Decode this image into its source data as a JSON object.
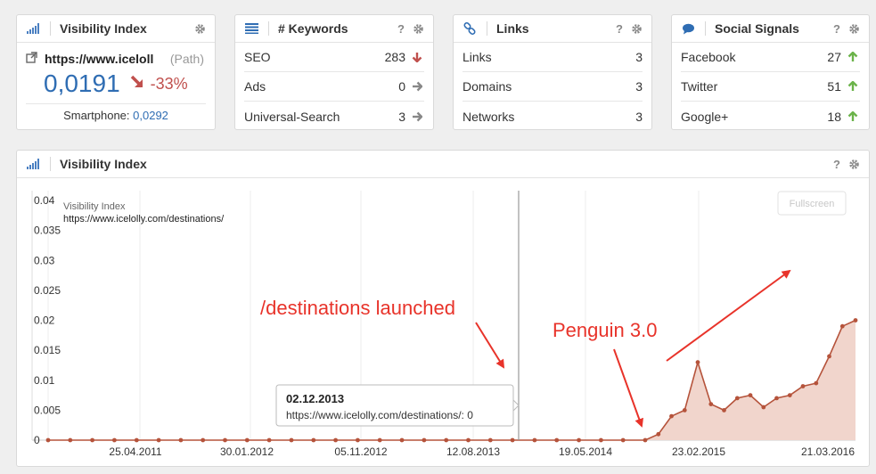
{
  "vi_card": {
    "title": "Visibility Index",
    "url": "https://www.iceloll",
    "path": "(Path)",
    "value": "0,0191",
    "change": "-33%",
    "smartphone_label": "Smartphone:",
    "smartphone_value": "0,0292"
  },
  "keywords_card": {
    "title": "# Keywords",
    "help": "?",
    "rows": [
      {
        "label": "SEO",
        "value": "283",
        "trend": "down"
      },
      {
        "label": "Ads",
        "value": "0",
        "trend": "flat"
      },
      {
        "label": "Universal-Search",
        "value": "3",
        "trend": "flat"
      }
    ]
  },
  "links_card": {
    "title": "Links",
    "help": "?",
    "rows": [
      {
        "label": "Links",
        "value": "3"
      },
      {
        "label": "Domains",
        "value": "3"
      },
      {
        "label": "Networks",
        "value": "3"
      }
    ]
  },
  "social_card": {
    "title": "Social Signals",
    "help": "?",
    "rows": [
      {
        "label": "Facebook",
        "value": "27",
        "trend": "up"
      },
      {
        "label": "Twitter",
        "value": "51",
        "trend": "up"
      },
      {
        "label": "Google+",
        "value": "18",
        "trend": "up"
      }
    ]
  },
  "chart_panel": {
    "title": "Visibility Index",
    "help": "?",
    "fullscreen": "Fullscreen",
    "inner_title": "Visibility Index",
    "inner_url": "https://www.icelolly.com/destinations/",
    "tooltip_date": "02.12.2013",
    "tooltip_text": "https://www.icelolly.com/destinations/: 0",
    "annotation_launch": "/destinations launched",
    "annotation_penguin": "Penguin 3.0"
  },
  "colors": {
    "accent_blue": "#2f6db3",
    "negative": "#c0504d",
    "positive": "#6bb34a",
    "series": "#b5533b",
    "series_fill": "#f1d5cc",
    "annotation": "#e8332a"
  },
  "chart_data": {
    "type": "area",
    "xlabel": "",
    "ylabel": "",
    "ylim": [
      0,
      0.04
    ],
    "yticks": [
      "0",
      "0.005",
      "0.01",
      "0.015",
      "0.02",
      "0.025",
      "0.03",
      "0.035",
      "0.04"
    ],
    "xticks": [
      "25.04.2011",
      "30.01.2012",
      "05.11.2012",
      "12.08.2013",
      "19.05.2014",
      "23.02.2015",
      "21.03.2016"
    ],
    "series": [
      {
        "name": "https://www.icelolly.com/destinations/",
        "x": [
          "2010-07",
          "2010-09",
          "2010-11",
          "2011-01",
          "2011-03",
          "2011-05",
          "2011-07",
          "2011-09",
          "2011-11",
          "2012-01",
          "2012-03",
          "2012-05",
          "2012-07",
          "2012-09",
          "2012-11",
          "2013-01",
          "2013-03",
          "2013-05",
          "2013-07",
          "2013-09",
          "2013-11",
          "2014-01",
          "2014-03",
          "2014-05",
          "2014-07",
          "2014-09",
          "2014-11",
          "2014-12",
          "2015-01",
          "2015-02",
          "2015-03",
          "2015-04",
          "2015-05",
          "2015-06",
          "2015-07",
          "2015-08",
          "2015-09",
          "2015-10",
          "2015-11",
          "2015-12",
          "2016-01",
          "2016-02",
          "2016-03",
          "2016-04"
        ],
        "y": [
          0,
          0,
          0,
          0,
          0,
          0,
          0,
          0,
          0,
          0,
          0,
          0,
          0,
          0,
          0,
          0,
          0,
          0,
          0,
          0,
          0,
          0,
          0,
          0,
          0,
          0,
          0,
          0,
          0.001,
          0.004,
          0.005,
          0.013,
          0.006,
          0.005,
          0.007,
          0.0075,
          0.0055,
          0.007,
          0.0075,
          0.009,
          0.0095,
          0.014,
          0.019,
          0.02
        ]
      }
    ]
  }
}
